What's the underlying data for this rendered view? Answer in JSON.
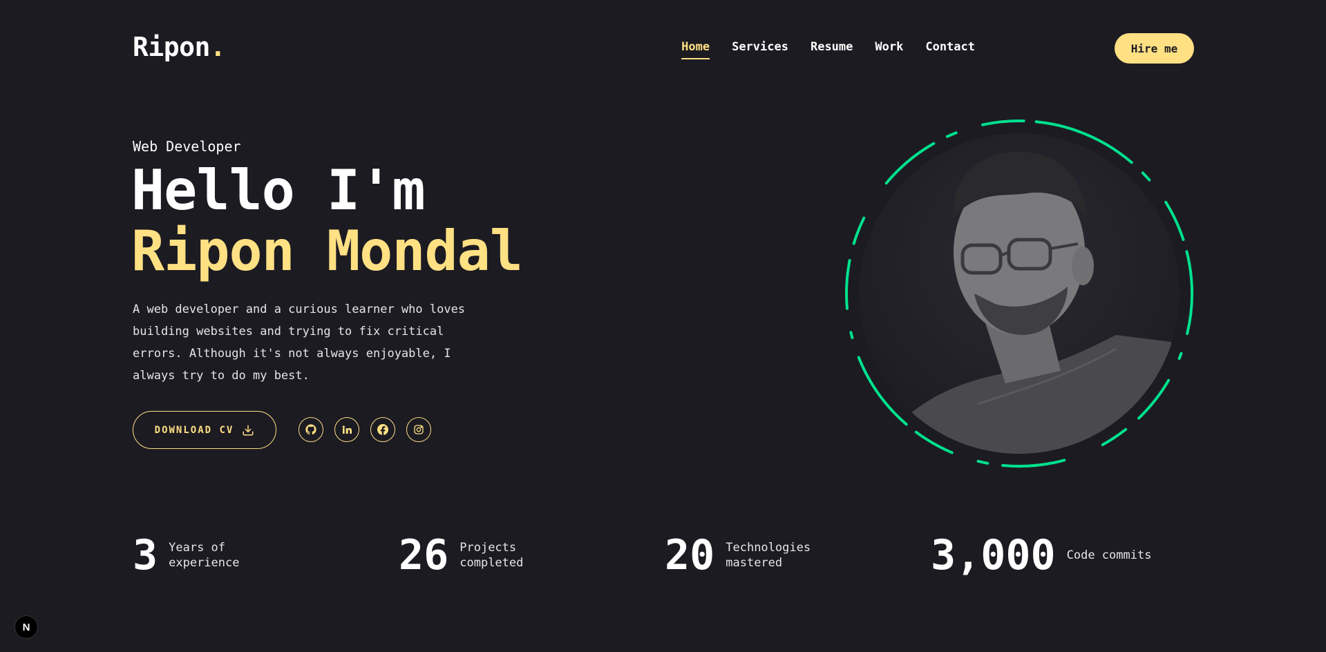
{
  "header": {
    "logo_text": "Ripon",
    "logo_dot": ".",
    "nav": [
      {
        "label": "Home",
        "active": true
      },
      {
        "label": "Services"
      },
      {
        "label": "Resume"
      },
      {
        "label": "Work"
      },
      {
        "label": "Contact"
      }
    ],
    "hire_label": "Hire me"
  },
  "hero": {
    "role": "Web Developer",
    "greeting": "Hello I'm",
    "name": "Ripon Mondal",
    "bio": "A web developer and a curious learner who loves building websites and trying to fix critical errors. Although it's not always enjoyable, I always try to do my best.",
    "cv_label": "DOWNLOAD CV",
    "cv_icon": "download-icon",
    "socials": [
      {
        "name": "github-icon"
      },
      {
        "name": "linkedin-icon"
      },
      {
        "name": "facebook-icon"
      },
      {
        "name": "instagram-icon"
      }
    ]
  },
  "stats": [
    {
      "value": "3",
      "label": "Years of experience"
    },
    {
      "value": "26",
      "label": "Projects completed"
    },
    {
      "value": "20",
      "label": "Technologies mastered"
    },
    {
      "value": "3,000",
      "label": "Code commits"
    }
  ],
  "badge": {
    "label": "N"
  },
  "colors": {
    "background": "#1c1b22",
    "accent": "#ffe083",
    "ring": "#00e18e"
  }
}
